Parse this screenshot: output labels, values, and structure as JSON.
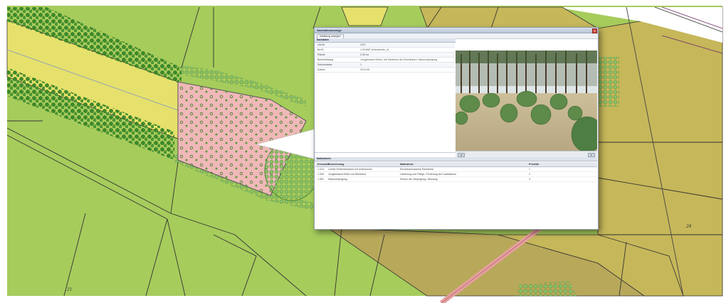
{
  "colors": {
    "map_green": "#a6cc5c",
    "map_olive": "#c6b75a",
    "map_yellow": "#e6e16c",
    "map_pink": "#f0b8b8",
    "tree_green": "#3c8a2a",
    "window_title_bg": "#c5d0de"
  },
  "map": {
    "label_a": "21",
    "label_b": "24"
  },
  "window": {
    "title": "Sachdatenanzeige",
    "close_icon": "close-icon",
    "toolbar": {
      "button_label": "Auflistung anzeigen"
    },
    "attributes": {
      "heading": "Sachdaten",
      "rows": [
        {
          "key": "Lfd.Nr.",
          "value": "1007"
        },
        {
          "key": "Bz.ID",
          "value": "1.024587 (Klimakiefer_2)"
        },
        {
          "key": "Fläche",
          "value": "0,95 ha"
        },
        {
          "key": "Beschreibung",
          "value": "Jungbestand Kiefer, mit Stieleiche als Einzelbaum; Naturverjüngung"
        },
        {
          "key": "Schutzstatus",
          "value": "1"
        },
        {
          "key": "Datum",
          "value": "2014-05"
        }
      ]
    },
    "photo": {
      "prev_label": "◄",
      "next_label": "►"
    },
    "measures": {
      "heading": "Maßnahmen",
      "columns": [
        "Kennzahl",
        "Bezeichnung",
        "Maßnahme",
        "Priorität"
      ],
      "rows": [
        [
          "1.013",
          "Lichter Kiefernbestand mit Unterwuchs",
          "Einzelstammweise Entnahme",
          "1"
        ],
        [
          "1.026",
          "Jungbestand Kiefer mit Stieleiche",
          "Läuterung und Pflege, Förderung der Laubbäume",
          "2"
        ],
        [
          "1.051",
          "Naturverjüngung",
          "Schutz der Verjüngung, Zäunung",
          "3"
        ]
      ]
    }
  }
}
